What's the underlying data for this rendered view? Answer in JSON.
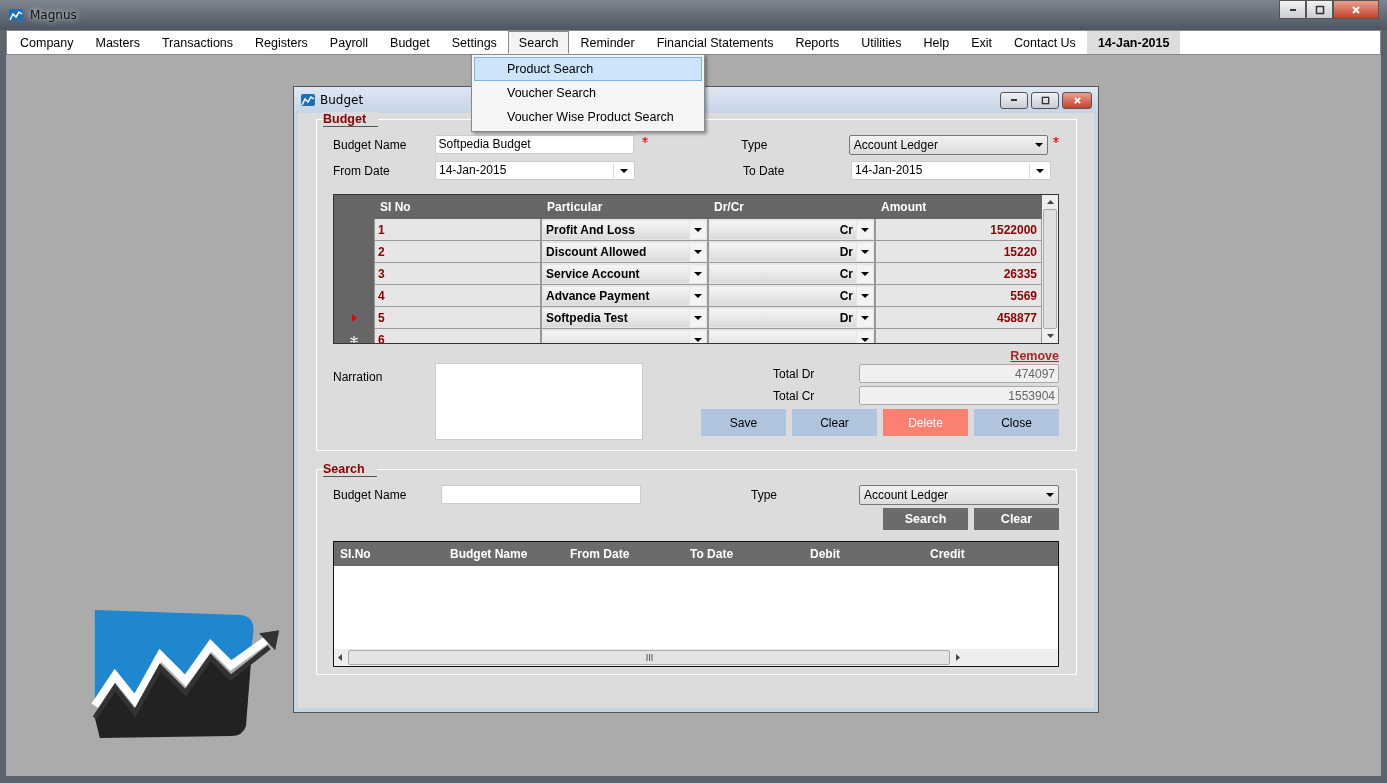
{
  "window": {
    "title": "Magnus"
  },
  "menu": [
    {
      "label": "Company",
      "selected": false,
      "kind": "item"
    },
    {
      "label": "Masters",
      "selected": false,
      "kind": "item"
    },
    {
      "label": "Transactions",
      "selected": false,
      "kind": "item"
    },
    {
      "label": "Registers",
      "selected": false,
      "kind": "item"
    },
    {
      "label": "Payroll",
      "selected": false,
      "kind": "item"
    },
    {
      "label": "Budget",
      "selected": false,
      "kind": "item"
    },
    {
      "label": "Settings",
      "selected": false,
      "kind": "item"
    },
    {
      "label": "Search",
      "selected": true,
      "kind": "item"
    },
    {
      "label": "Reminder",
      "selected": false,
      "kind": "item"
    },
    {
      "label": "Financial Statements",
      "selected": false,
      "kind": "item"
    },
    {
      "label": "Reports",
      "selected": false,
      "kind": "item"
    },
    {
      "label": "Utilities",
      "selected": false,
      "kind": "item"
    },
    {
      "label": "Help",
      "selected": false,
      "kind": "item"
    },
    {
      "label": "Exit",
      "selected": false,
      "kind": "item"
    },
    {
      "label": "Contact Us",
      "selected": false,
      "kind": "item"
    },
    {
      "label": "14-Jan-2015",
      "selected": false,
      "kind": "date"
    }
  ],
  "search_menu": [
    {
      "label": "Product Search",
      "selected": true
    },
    {
      "label": "Voucher Search",
      "selected": false
    },
    {
      "label": "Voucher Wise Product Search",
      "selected": false
    }
  ],
  "dialog": {
    "title": "Budget",
    "budget_group": {
      "title": "Budget",
      "budget_name": {
        "label": "Budget Name",
        "value": "Softpedia Budget",
        "required": true
      },
      "type": {
        "label": "Type",
        "value": "Account Ledger",
        "required": true
      },
      "from_date": {
        "label": "From Date",
        "value": "14-Jan-2015"
      },
      "to_date": {
        "label": "To Date",
        "value": "14-Jan-2015"
      },
      "grid": {
        "columns": [
          "SI No",
          "Particular",
          "Dr/Cr",
          "Amount"
        ],
        "rows": [
          {
            "kind": "data",
            "current": false,
            "si_no": "1",
            "particular": "Profit And Loss",
            "dr_cr": "Cr",
            "amount": "1522000"
          },
          {
            "kind": "data",
            "current": false,
            "si_no": "2",
            "particular": "Discount Allowed",
            "dr_cr": "Dr",
            "amount": "15220"
          },
          {
            "kind": "data",
            "current": false,
            "si_no": "3",
            "particular": "Service Account",
            "dr_cr": "Cr",
            "amount": "26335"
          },
          {
            "kind": "data",
            "current": false,
            "si_no": "4",
            "particular": "Advance Payment",
            "dr_cr": "Cr",
            "amount": "5569"
          },
          {
            "kind": "data",
            "current": true,
            "si_no": "5",
            "particular": "Softpedia Test",
            "dr_cr": "Dr",
            "amount": "458877"
          },
          {
            "kind": "new",
            "current": false,
            "si_no": "6",
            "particular": "",
            "dr_cr": "",
            "amount": ""
          }
        ]
      },
      "remove_link": "Remove",
      "narration": {
        "label": "Narration"
      },
      "total_dr": {
        "label": "Total Dr",
        "value": "474097"
      },
      "total_cr": {
        "label": "Total Cr",
        "value": "1553904"
      },
      "buttons": [
        {
          "label": "Save",
          "kind": "normal"
        },
        {
          "label": "Clear",
          "kind": "normal"
        },
        {
          "label": "Delete",
          "kind": "danger"
        },
        {
          "label": "Close",
          "kind": "normal"
        }
      ]
    },
    "search_group": {
      "title": "Search",
      "budget_name": {
        "label": "Budget Name"
      },
      "type": {
        "label": "Type",
        "value": "Account Ledger"
      },
      "buttons": [
        "Search",
        "Clear"
      ],
      "columns": [
        "SI.No",
        "Budget Name",
        "From Date",
        "To Date",
        "Debit",
        "Credit"
      ]
    }
  }
}
